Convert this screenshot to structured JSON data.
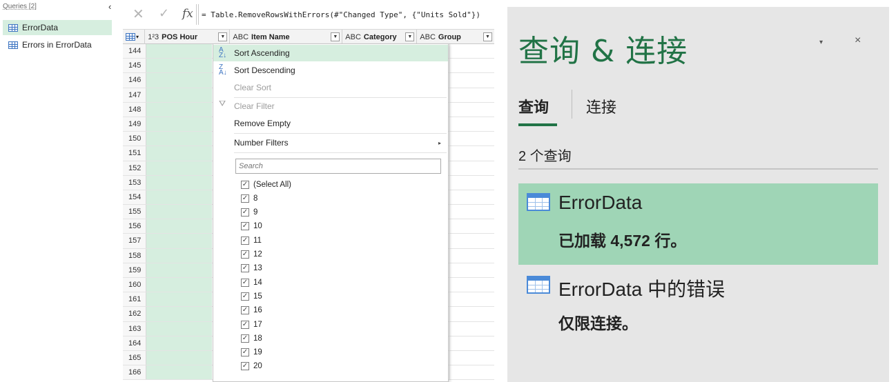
{
  "queries_pane": {
    "title": "Queries [2]",
    "collapse_icon": "‹",
    "items": [
      {
        "label": "ErrorData"
      },
      {
        "label": "Errors in ErrorData"
      }
    ]
  },
  "formula_bar": {
    "cancel_icon": "✕",
    "accept_icon": "✓",
    "fx_label": "fx",
    "formula": "= Table.RemoveRowsWithErrors(#\"Changed Type\", {\"Units Sold\"})"
  },
  "grid": {
    "columns": [
      {
        "type": "1²3",
        "name": "POS Hour"
      },
      {
        "type": "A^B_C",
        "name": "Item Name"
      },
      {
        "type": "A^B_C",
        "name": "Category"
      },
      {
        "type": "A^B_C",
        "name": "Group"
      }
    ],
    "column_type_labels": [
      "1²3",
      "ABC",
      "ABC",
      "ABC"
    ],
    "row_numbers": [
      "144",
      "145",
      "146",
      "147",
      "148",
      "149",
      "150",
      "151",
      "152",
      "153",
      "154",
      "155",
      "156",
      "157",
      "158",
      "159",
      "160",
      "161",
      "162",
      "163",
      "164",
      "165",
      "166"
    ]
  },
  "dropdown": {
    "sort_ascending": "Sort Ascending",
    "sort_descending": "Sort Descending",
    "clear_sort": "Clear Sort",
    "clear_filter": "Clear Filter",
    "remove_empty": "Remove Empty",
    "number_filters": "Number Filters",
    "submenu_arrow": "▸",
    "search_placeholder": "Search",
    "checkbox_items": [
      "(Select All)",
      "8",
      "9",
      "10",
      "11",
      "12",
      "13",
      "14",
      "15",
      "16",
      "17",
      "18",
      "19",
      "20"
    ],
    "check_mark": "✓"
  },
  "task_pane": {
    "title": "查询 & 连接",
    "dropdown_icon": "▾",
    "close_icon": "×",
    "tab_queries": "查询",
    "tab_connections": "连接",
    "count_label": "2 个查询",
    "queries": [
      {
        "name": "ErrorData",
        "status": "已加载 4,572 行。"
      },
      {
        "name": "ErrorData 中的错误",
        "status": "仅限连接。"
      }
    ]
  },
  "colors": {
    "accent_green": "#217346",
    "selection_green": "#9fd5b6",
    "column_highlight": "#d6eedf",
    "pane_background": "#e6e6e6"
  }
}
